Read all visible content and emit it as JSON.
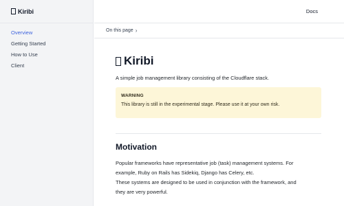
{
  "sidebar": {
    "brand": "Kiribi",
    "items": [
      {
        "label": "Overview",
        "active": true
      },
      {
        "label": "Getting Started",
        "active": false
      },
      {
        "label": "How to Use",
        "active": false
      },
      {
        "label": "Client",
        "active": false
      }
    ]
  },
  "header": {
    "docs_label": "Docs"
  },
  "toc": {
    "label": "On this page"
  },
  "main": {
    "title": "Kiribi",
    "lead": "A simple job management library consisting of the Cloudflare stack.",
    "warning": {
      "title": "WARNING",
      "text": "This library is still in the experimental stage. Please use it at your own risk."
    },
    "motivation": {
      "heading": "Motivation",
      "lines": [
        "Popular frameworks have representative job (task) management systems. For",
        "example, Ruby on Rails has Sidekiq, Django has Celery, etc.",
        "These systems are designed to be used in conjunction with the framework, and",
        "they are very powerful."
      ]
    }
  },
  "colors": {
    "accent": "#3e63dd",
    "warning_bg": "#fdf6d8",
    "sidebar_bg": "#f3f4f6"
  },
  "icons": {
    "brand": "logo-icon",
    "toc": "chevron-right-icon"
  }
}
